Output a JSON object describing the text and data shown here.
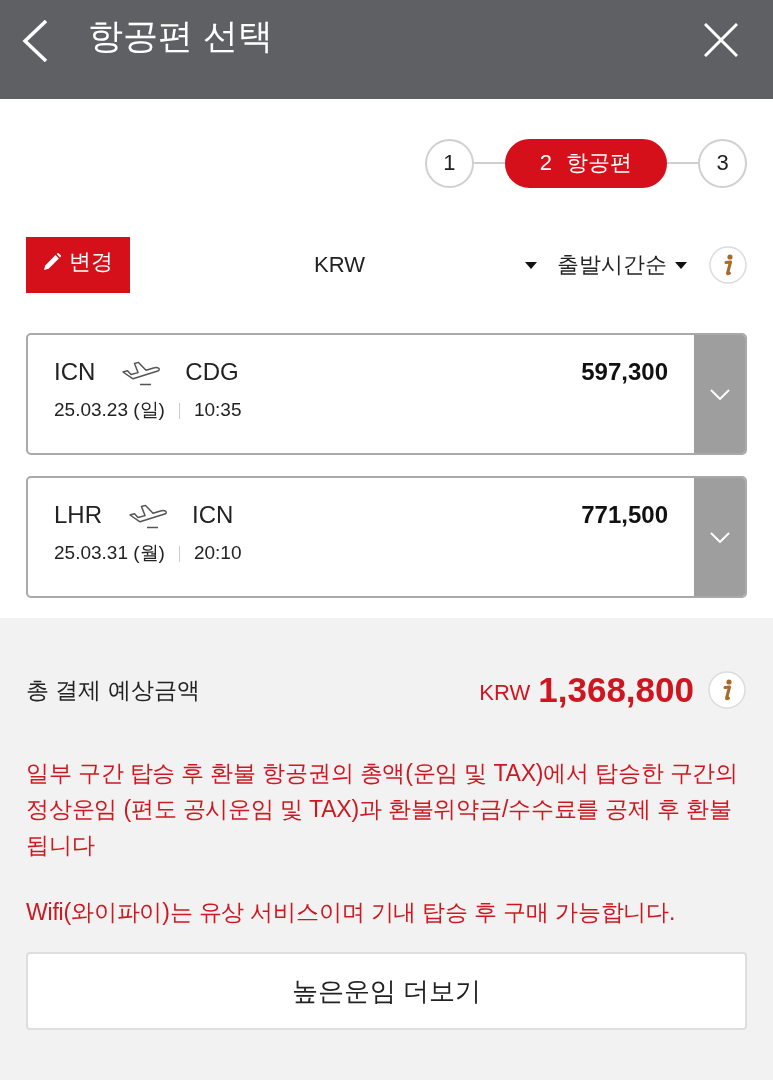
{
  "header": {
    "title": "항공편 선택"
  },
  "steps": [
    {
      "number": "1",
      "selected": false
    },
    {
      "number": "2",
      "label": "항공편",
      "selected": true
    },
    {
      "number": "3",
      "selected": false
    }
  ],
  "toolbar": {
    "edit_button": "변경",
    "currency": "KRW",
    "sort": "출발시간순"
  },
  "flights": [
    {
      "from": "ICN",
      "to": "CDG",
      "date": "25.03.23 (일)",
      "time": "10:35",
      "price": "597,300",
      "expanded": false
    },
    {
      "from": "LHR",
      "to": "ICN",
      "date": "25.03.31 (월)",
      "time": "20:10",
      "price": "771,500",
      "expanded": false
    }
  ],
  "total": {
    "label": "총 결제 예상금액",
    "currency": "KRW",
    "amount": "1,368,800"
  },
  "notices": [
    "일부 구간 탑승 후 환불 항공권의 총액(운임 및 TAX)에서 탑승한 구간의 정상운임 (편도 공시운임 및 TAX)과 환불위약금/수수료를 공제 후 환불됩니다",
    "Wifi(와이파이)는 유상 서비스이며 기내 탑승 후 구매 가능합니다."
  ],
  "more_button": "높은운임 더보기"
}
